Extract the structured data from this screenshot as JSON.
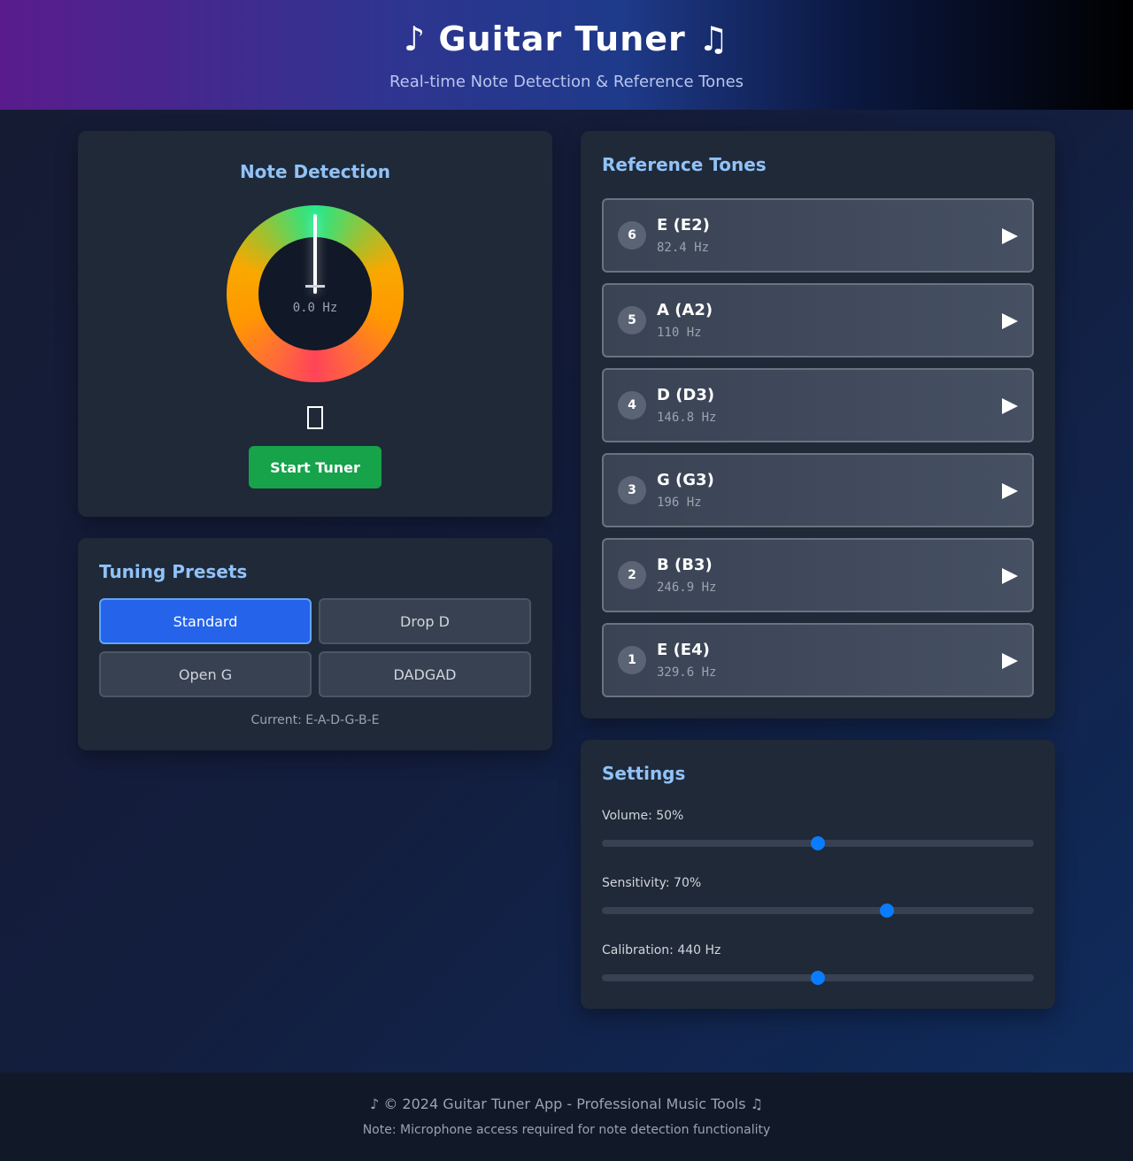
{
  "header": {
    "title": "♪ Guitar Tuner ♫",
    "subtitle": "Real-time Note Detection & Reference Tones"
  },
  "note_detection": {
    "title": "Note Detection",
    "frequency": "0.0 Hz",
    "mic_icon": "microphone-icon",
    "start_button": "Start Tuner",
    "start_color": "#16a34a"
  },
  "presets": {
    "title": "Tuning Presets",
    "items": [
      "Standard",
      "Drop D",
      "Open G",
      "DADGAD"
    ],
    "selected": "Standard",
    "current": "Current: E-A-D-G-B-E"
  },
  "reference_tones": {
    "title": "Reference Tones",
    "play_icon": "play-icon",
    "strings": [
      {
        "number": "6",
        "note": "E (E2)",
        "hz": "82.4 Hz"
      },
      {
        "number": "5",
        "note": "A (A2)",
        "hz": "110 Hz"
      },
      {
        "number": "4",
        "note": "D (D3)",
        "hz": "146.8 Hz"
      },
      {
        "number": "3",
        "note": "G (G3)",
        "hz": "196 Hz"
      },
      {
        "number": "2",
        "note": "B (B3)",
        "hz": "246.9 Hz"
      },
      {
        "number": "1",
        "note": "E (E4)",
        "hz": "329.6 Hz"
      }
    ]
  },
  "settings": {
    "title": "Settings",
    "volume": {
      "label": "Volume: 50%",
      "value": 0.5
    },
    "sensitivity": {
      "label": "Sensitivity: 70%",
      "value": 0.66
    },
    "calibration": {
      "label": "Calibration: 440 Hz",
      "value": 0.5
    },
    "accent": "#0a7cff"
  },
  "footer": {
    "line1": "♪ © 2024 Guitar Tuner App - Professional Music Tools ♫",
    "line2": "Note: Microphone access required for note detection functionality"
  }
}
